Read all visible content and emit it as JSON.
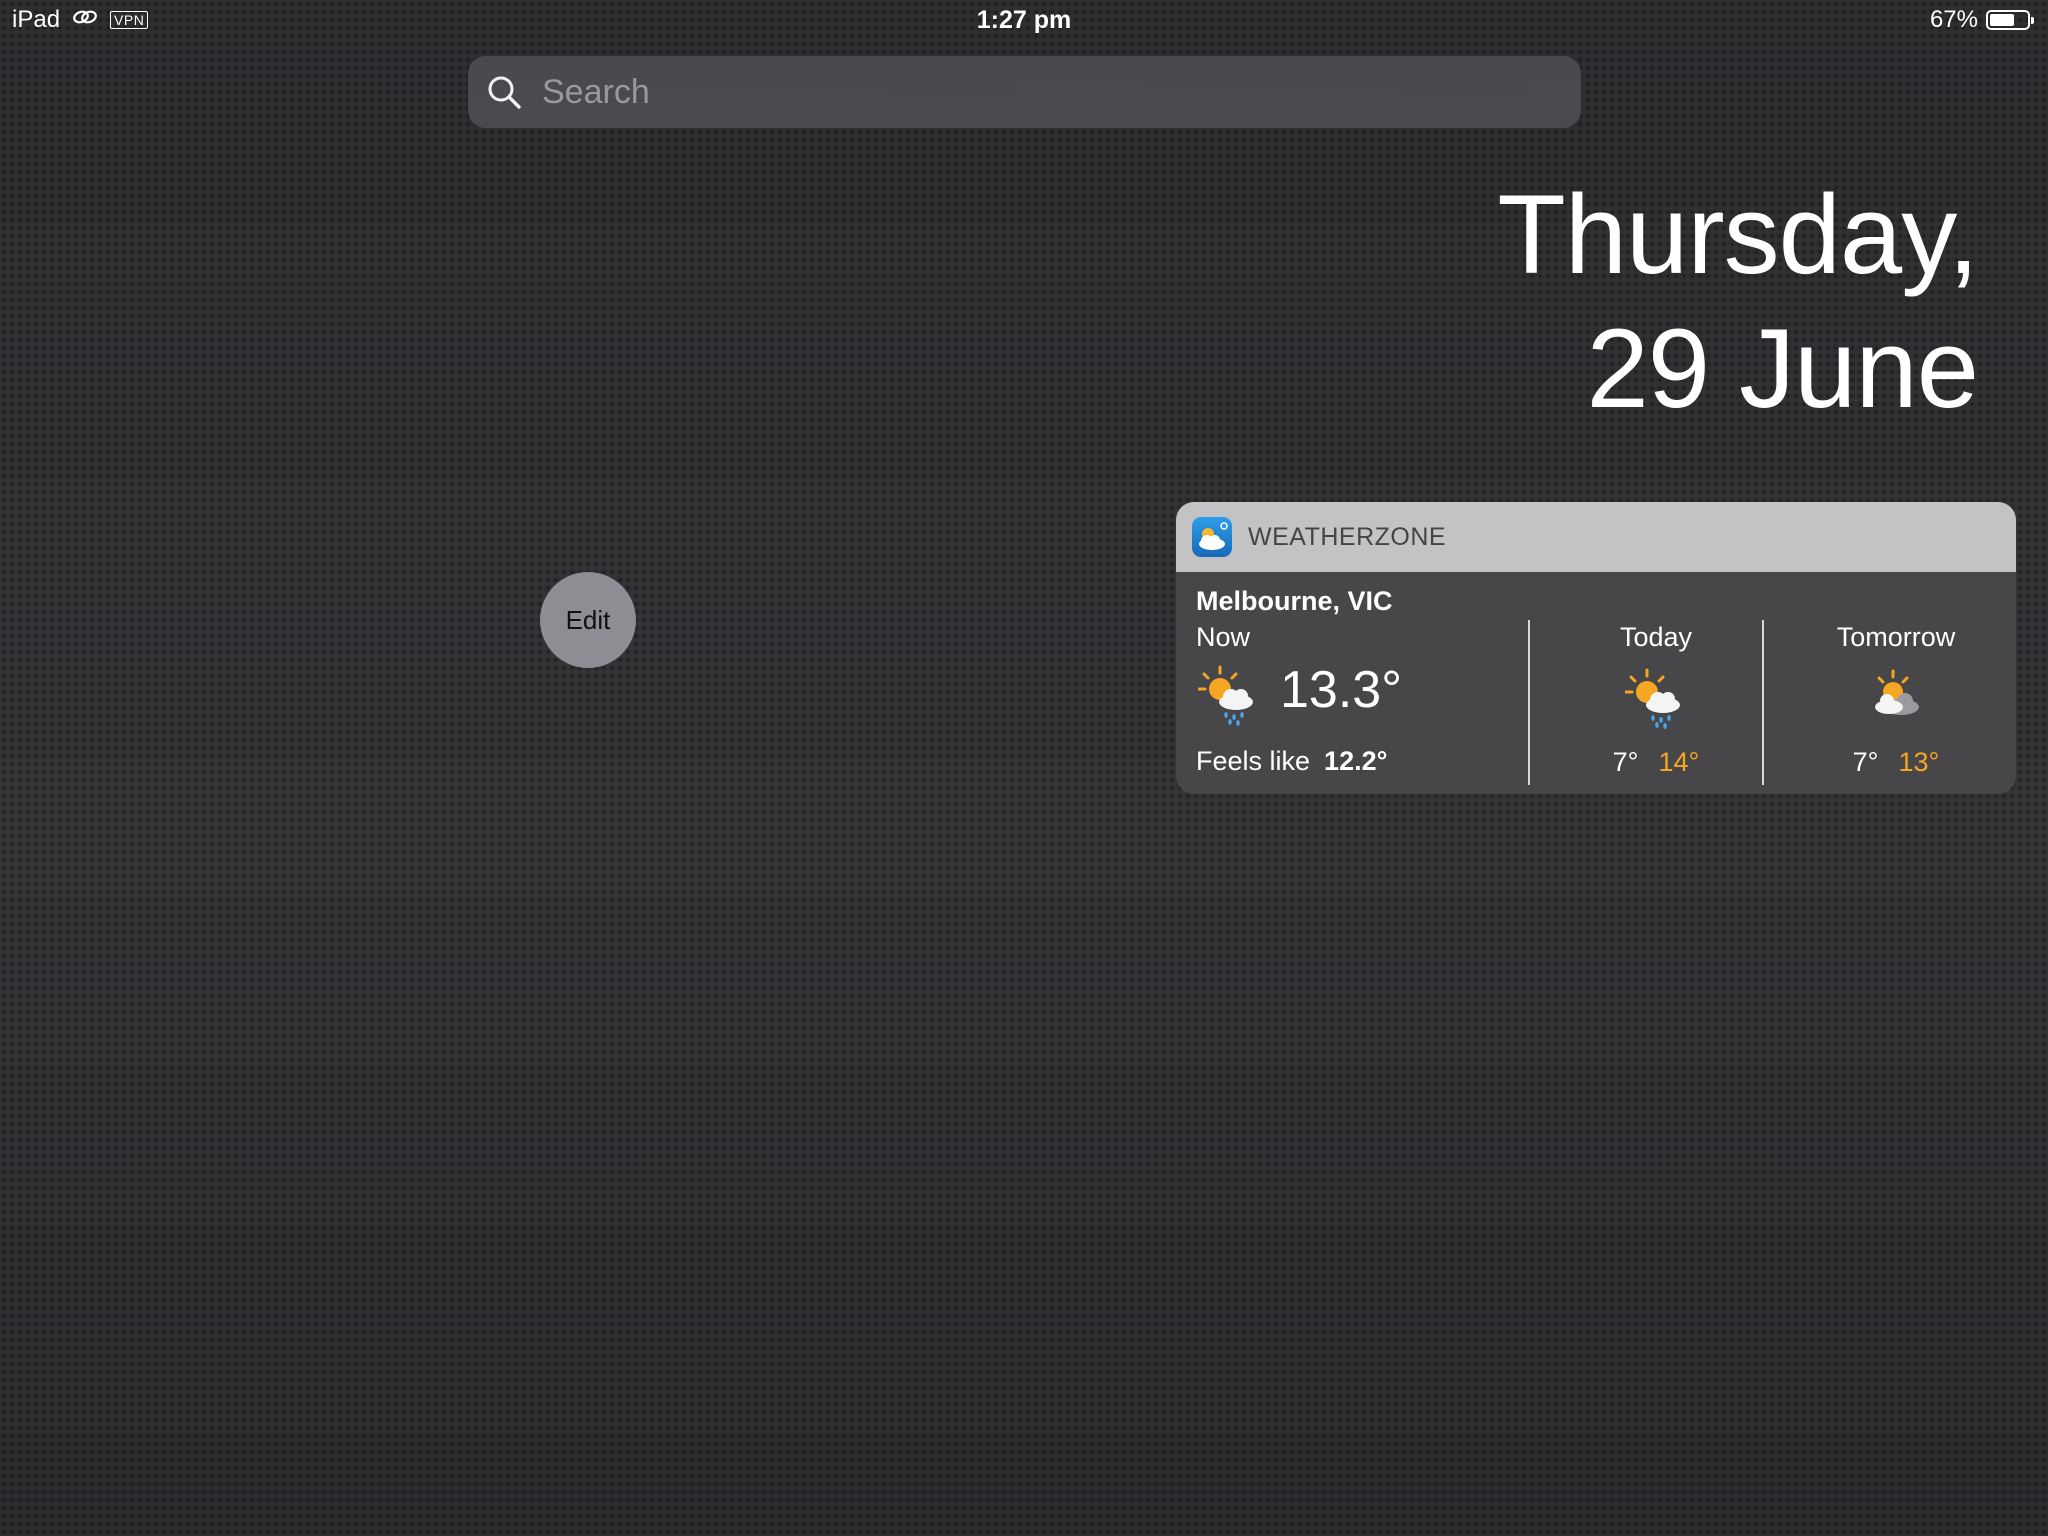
{
  "status_bar": {
    "device": "iPad",
    "vpn": "VPN",
    "time": "1:27 pm",
    "battery_text": "67%",
    "battery_level": 0.67
  },
  "search": {
    "placeholder": "Search"
  },
  "date": {
    "line1": "Thursday,",
    "line2": "29 June"
  },
  "edit": {
    "label": "Edit"
  },
  "widget": {
    "app_name": "WEATHERZONE",
    "location": "Melbourne, VIC",
    "now": {
      "label": "Now",
      "temp": "13.3°",
      "feels_label": "Feels like",
      "feels_value": "12.2°",
      "icon": "sun-cloud-rain-icon"
    },
    "forecast": [
      {
        "label": "Today",
        "min": "7°",
        "max": "14°",
        "icon": "sun-cloud-rain-icon"
      },
      {
        "label": "Tomorrow",
        "min": "7°",
        "max": "13°",
        "icon": "sun-cloud-icon"
      }
    ]
  },
  "colors": {
    "max_temp": "#f5a623",
    "widget_header": "#c3c3c5",
    "widget_body": "#48484a"
  }
}
